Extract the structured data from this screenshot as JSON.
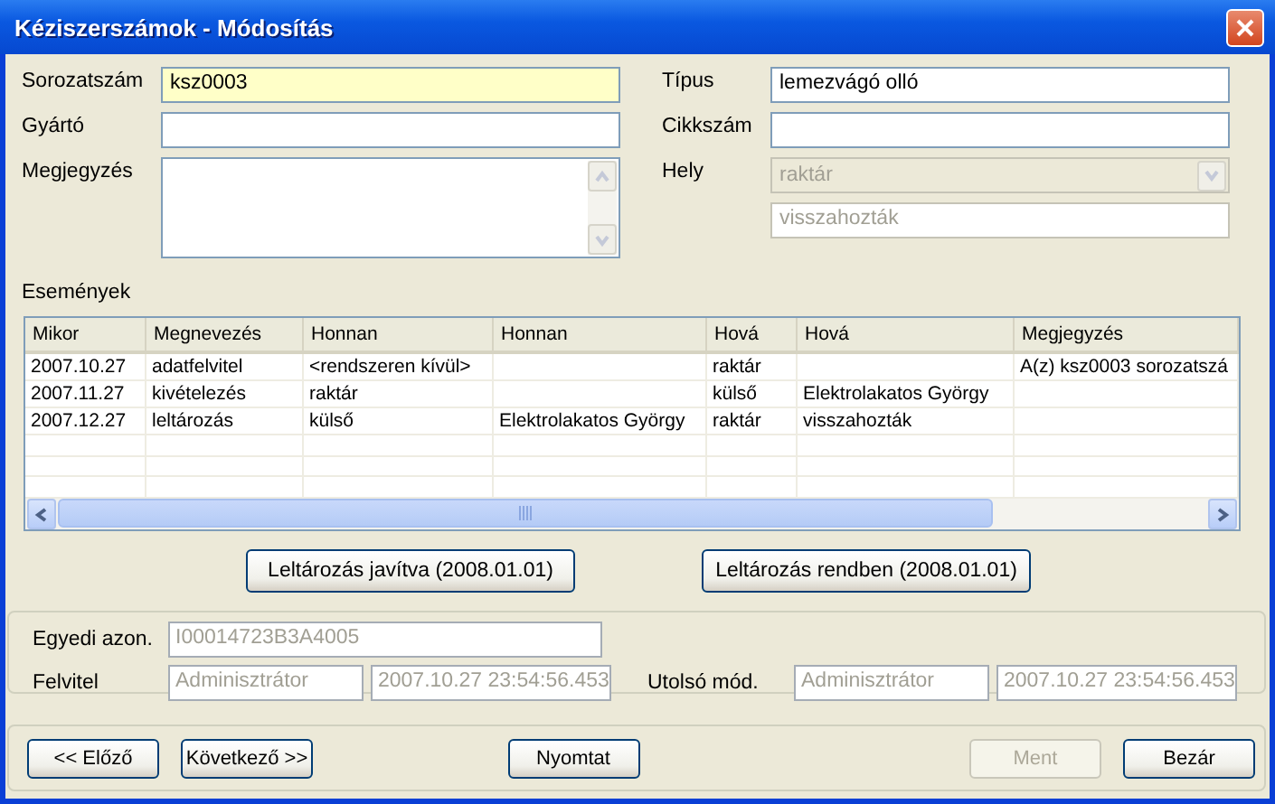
{
  "window": {
    "title": "Kéziszerszámok - Módosítás"
  },
  "form": {
    "left": [
      {
        "kind": "text",
        "label": "Sorozatszám",
        "value": "ksz0003",
        "focused": true,
        "disabled": false
      },
      {
        "kind": "text",
        "label": "Gyártó",
        "focused": false,
        "disabled": false
      },
      {
        "kind": "memo",
        "label": "Megjegyzés",
        "focused": false,
        "disabled": false
      }
    ],
    "right": [
      {
        "kind": "text",
        "label": "Típus",
        "value": "lemezvágó olló",
        "focused": false,
        "disabled": false
      },
      {
        "kind": "text",
        "label": "Cikkszám",
        "focused": false,
        "disabled": false
      },
      {
        "kind": "combo",
        "label": "Hely",
        "value": "raktár",
        "focused": false,
        "disabled": true
      },
      {
        "kind": "text",
        "value": "visszahozták",
        "focused": false,
        "disabled": true
      }
    ]
  },
  "events": {
    "label": "Események",
    "columns": [
      "Mikor",
      "Megnevezés",
      "Honnan",
      "Honnan",
      "Hová",
      "Hová",
      "Megjegyzés"
    ],
    "rows": [
      [
        "2007.10.27",
        "adatfelvitel",
        "<rendszeren kívül>",
        null,
        "raktár",
        null,
        "A(z) ksz0003 sorozatszá"
      ],
      [
        "2007.11.27",
        "kivételezés",
        "raktár",
        null,
        "külső",
        "Elektrolakatos György",
        null
      ],
      [
        "2007.12.27",
        "leltározás",
        "külső",
        "Elektrolakatos György",
        "raktár",
        "visszahozták",
        null
      ]
    ]
  },
  "inventory_buttons": [
    {
      "label": "Leltározás javítva (2008.01.01)",
      "disabled": false
    },
    {
      "label": "Leltározás rendben (2008.01.01)",
      "disabled": false
    }
  ],
  "record_info": {
    "id_label": "Egyedi azon.",
    "id_value": "I00014723B3A4005",
    "created_label": "Felvitel",
    "created_by": "Adminisztrátor",
    "created_at": "2007.10.27 23:54:56.453",
    "modified_label": "Utolsó mód.",
    "modified_by": "Adminisztrátor",
    "modified_at": "2007.10.27 23:54:56.453"
  },
  "footer_buttons": [
    {
      "label": "<< Előző",
      "disabled": false
    },
    {
      "label": "Következő >>",
      "disabled": false
    },
    {
      "label": "Nyomtat",
      "disabled": false
    },
    {
      "label": "Ment",
      "disabled": true
    },
    {
      "label": "Bezár",
      "disabled": false
    }
  ]
}
